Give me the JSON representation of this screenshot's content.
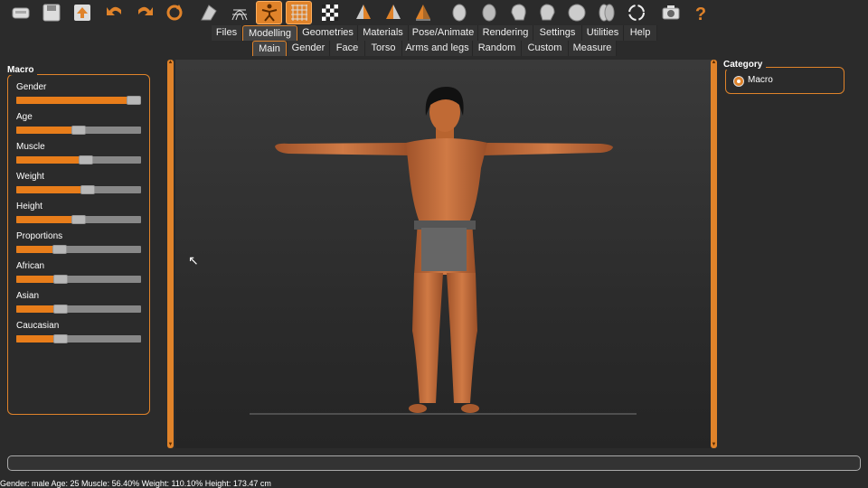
{
  "toolbar": {
    "icons": [
      "hard-drive-icon",
      "floppy-save-icon",
      "export-arrow-icon",
      "undo-icon",
      "redo-icon",
      "reset-icon",
      "smooth-icon",
      "wireframe-icon",
      "pose-figure-icon",
      "grid-icon",
      "checkerboard-icon",
      "front-view-icon",
      "left-view-icon",
      "right-view-icon",
      "head-front-icon",
      "head-back-icon",
      "head-left-icon",
      "head-right-icon",
      "head-top-icon",
      "head-bottom-icon",
      "reset-camera-icon",
      "camera-icon",
      "help-icon"
    ]
  },
  "tabs": [
    "Files",
    "Modelling",
    "Geometries",
    "Materials",
    "Pose/Animate",
    "Rendering",
    "Settings",
    "Utilities",
    "Help"
  ],
  "active_tab": "Modelling",
  "subtabs": [
    "Main",
    "Gender",
    "Face",
    "Torso",
    "Arms and legs",
    "Random",
    "Custom",
    "Measure"
  ],
  "active_subtab": "Main",
  "macro": {
    "title": "Macro",
    "sliders": [
      {
        "label": "Gender",
        "value": 1.0
      },
      {
        "label": "Age",
        "value": 0.5
      },
      {
        "label": "Muscle",
        "value": 0.564
      },
      {
        "label": "Weight",
        "value": 0.58
      },
      {
        "label": "Height",
        "value": 0.5
      },
      {
        "label": "Proportions",
        "value": 0.33
      },
      {
        "label": "African",
        "value": 0.333
      },
      {
        "label": "Asian",
        "value": 0.333
      },
      {
        "label": "Caucasian",
        "value": 0.333
      }
    ]
  },
  "category": {
    "title": "Category",
    "option": "Macro"
  },
  "status": "Gender: male Age: 25 Muscle: 56.40% Weight: 110.10% Height: 173.47 cm",
  "colors": {
    "accent": "#e0832a",
    "fill": "#e87d1a",
    "skin": "#c06a35",
    "cloth": "#666666"
  }
}
